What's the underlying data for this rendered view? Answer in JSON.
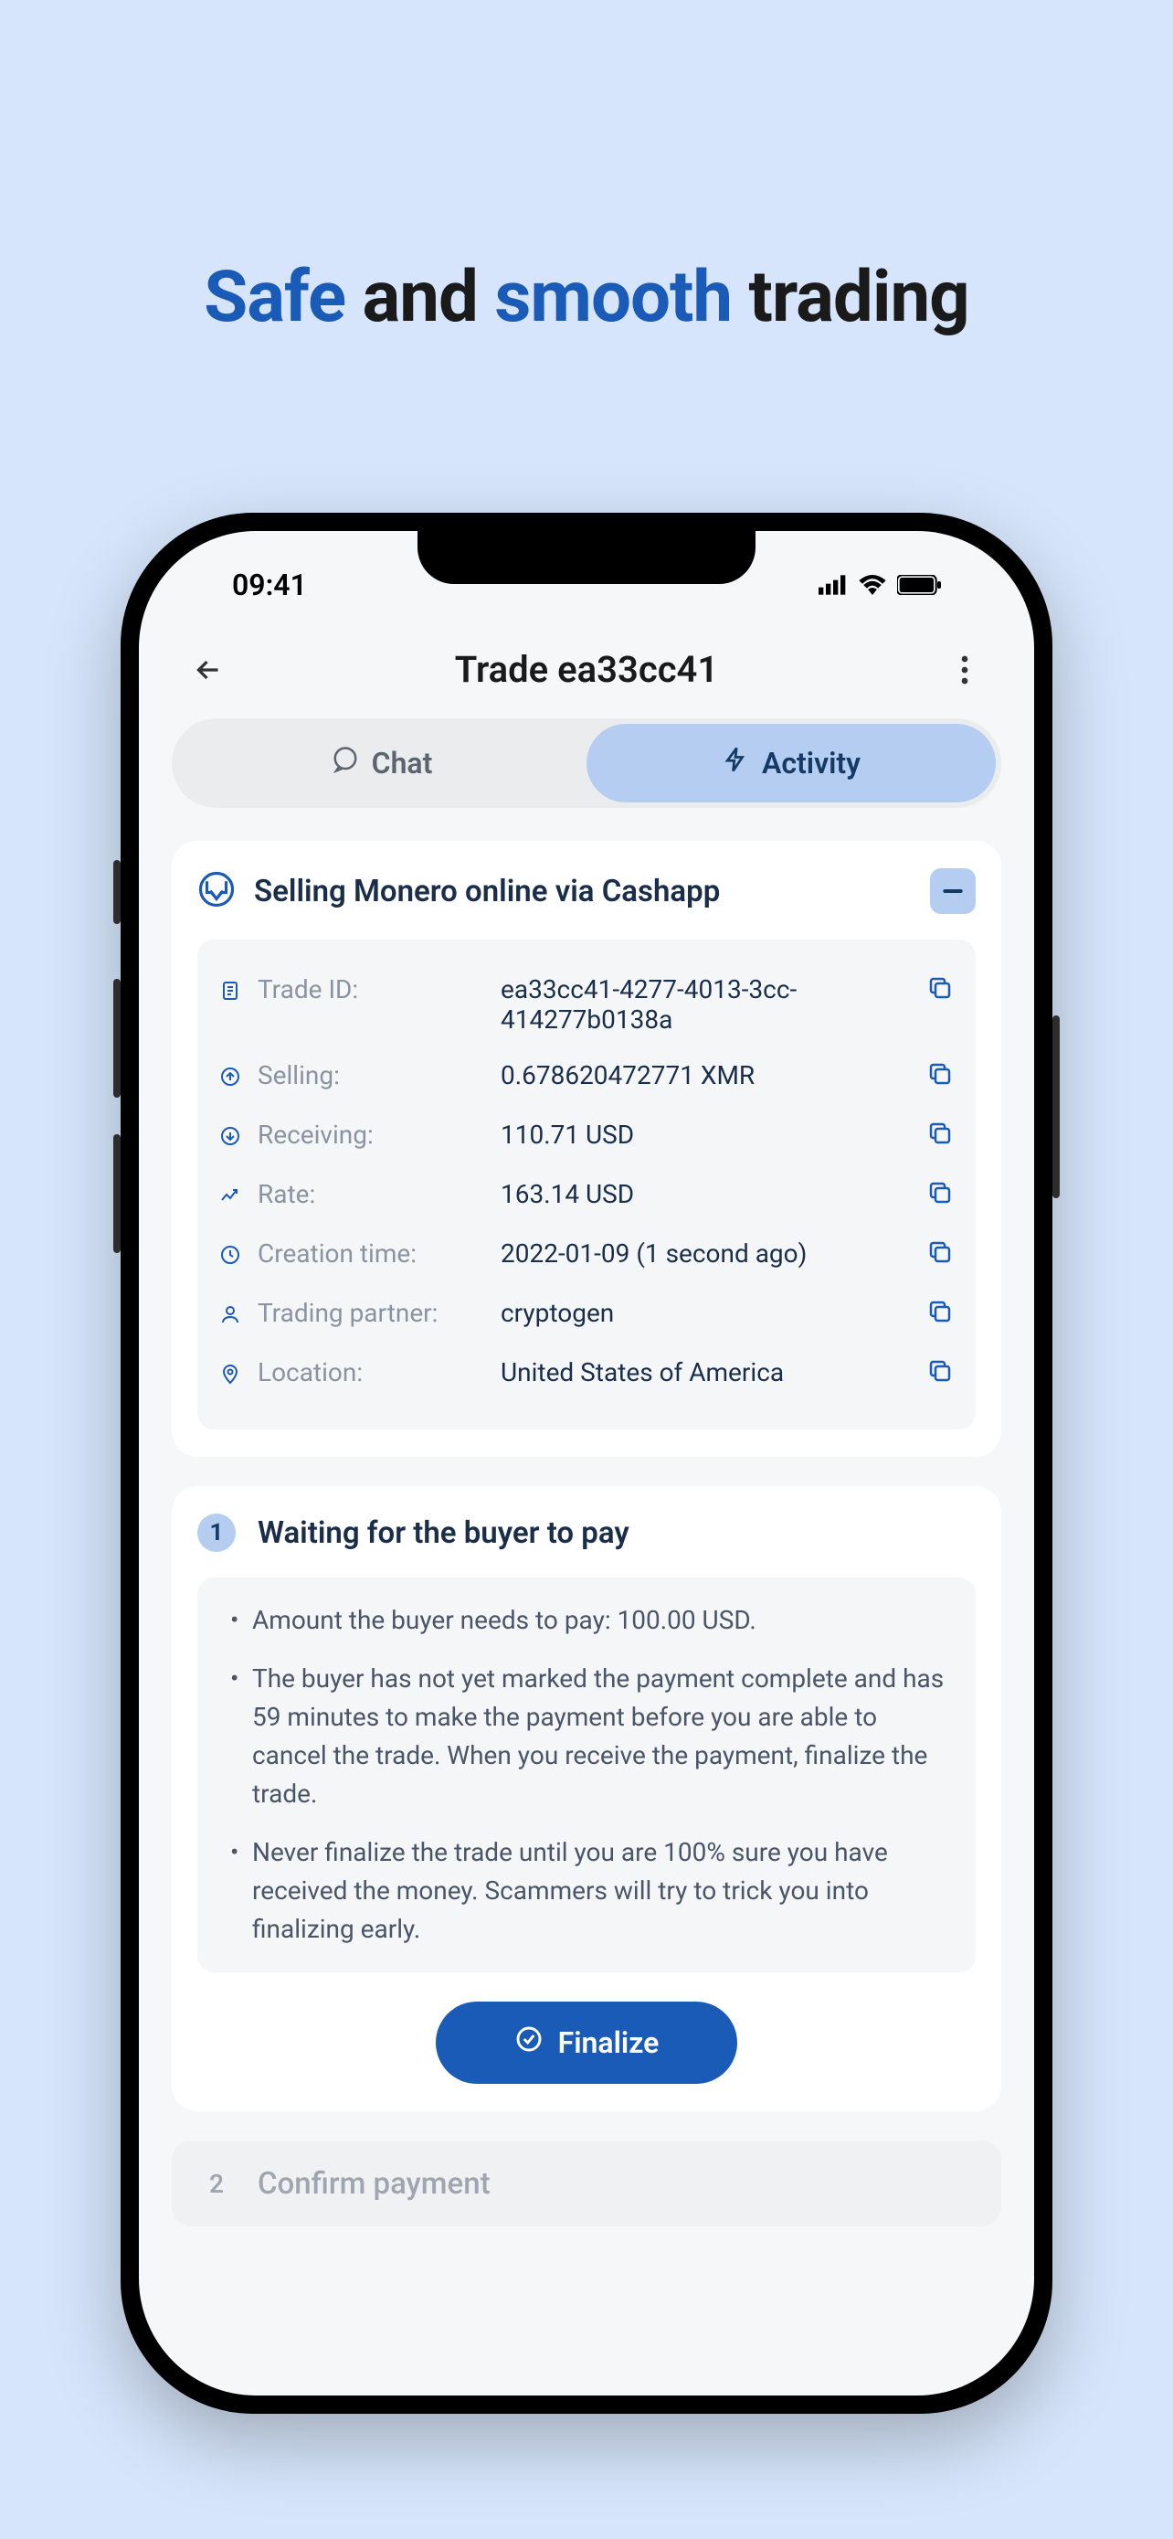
{
  "headline": {
    "w1": "Safe",
    "w2": "and",
    "w3": "smooth",
    "w4": "trading"
  },
  "status": {
    "time": "09:41"
  },
  "header": {
    "title": "Trade ea33cc41"
  },
  "tabs": {
    "chat": "Chat",
    "activity": "Activity"
  },
  "trade": {
    "title": "Selling Monero online via Cashapp",
    "rows": [
      {
        "label": "Trade ID:",
        "value": "ea33cc41-4277-4013-3cc-414277b0138a"
      },
      {
        "label": "Selling:",
        "value": "0.678620472771 XMR"
      },
      {
        "label": "Receiving:",
        "value": "110.71 USD"
      },
      {
        "label": "Rate:",
        "value": "163.14 USD"
      },
      {
        "label": "Creation time:",
        "value": "2022-01-09 (1 second ago)"
      },
      {
        "label": "Trading partner:",
        "value": "cryptogen"
      },
      {
        "label": "Location:",
        "value": "United States of America"
      }
    ]
  },
  "step1": {
    "num": "1",
    "title": "Waiting for the buyer to pay",
    "bullets": [
      "Amount the buyer needs to pay: 100.00 USD.",
      "The buyer has not yet marked the payment complete and has 59 minutes to make the payment before you are able to cancel the trade. When you receive the payment, finalize the trade.",
      "Never finalize the trade until you are 100% sure you have received the money. Scammers will try to trick you into finalizing early."
    ],
    "button": "Finalize"
  },
  "step2": {
    "num": "2",
    "title": "Confirm payment"
  }
}
